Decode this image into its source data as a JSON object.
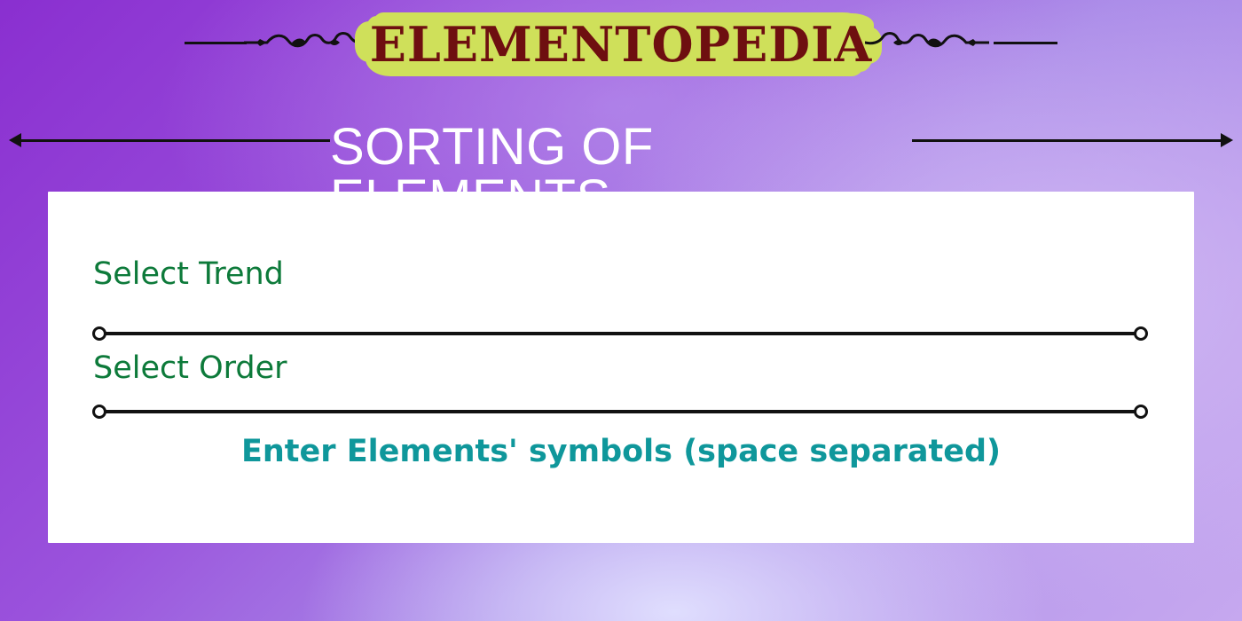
{
  "brand": {
    "title": "ELEMENTOPEDIA",
    "highlight_color": "#cfe05a",
    "title_color": "#6e0f10"
  },
  "section": {
    "title": "SORTING OF ELEMENTS"
  },
  "form": {
    "trend": {
      "label": "Select Trend",
      "value": ""
    },
    "order": {
      "label": "Select Order",
      "value": ""
    },
    "symbols": {
      "prompt": "Enter Elements' symbols (space separated)",
      "value": ""
    }
  },
  "icons": {
    "brand_left": "ornamental-flourish-icon",
    "brand_right": "ornamental-flourish-icon",
    "section_left": "left-arrow-icon",
    "section_right": "right-arrow-icon",
    "slider_start": "circle-handle-icon",
    "slider_end": "circle-handle-icon"
  },
  "colors": {
    "label_green": "#0d7a3a",
    "prompt_teal": "#0f979b",
    "card_background": "#ffffff",
    "background_start": "#8a2fd0",
    "background_end": "#c6a8ef"
  }
}
